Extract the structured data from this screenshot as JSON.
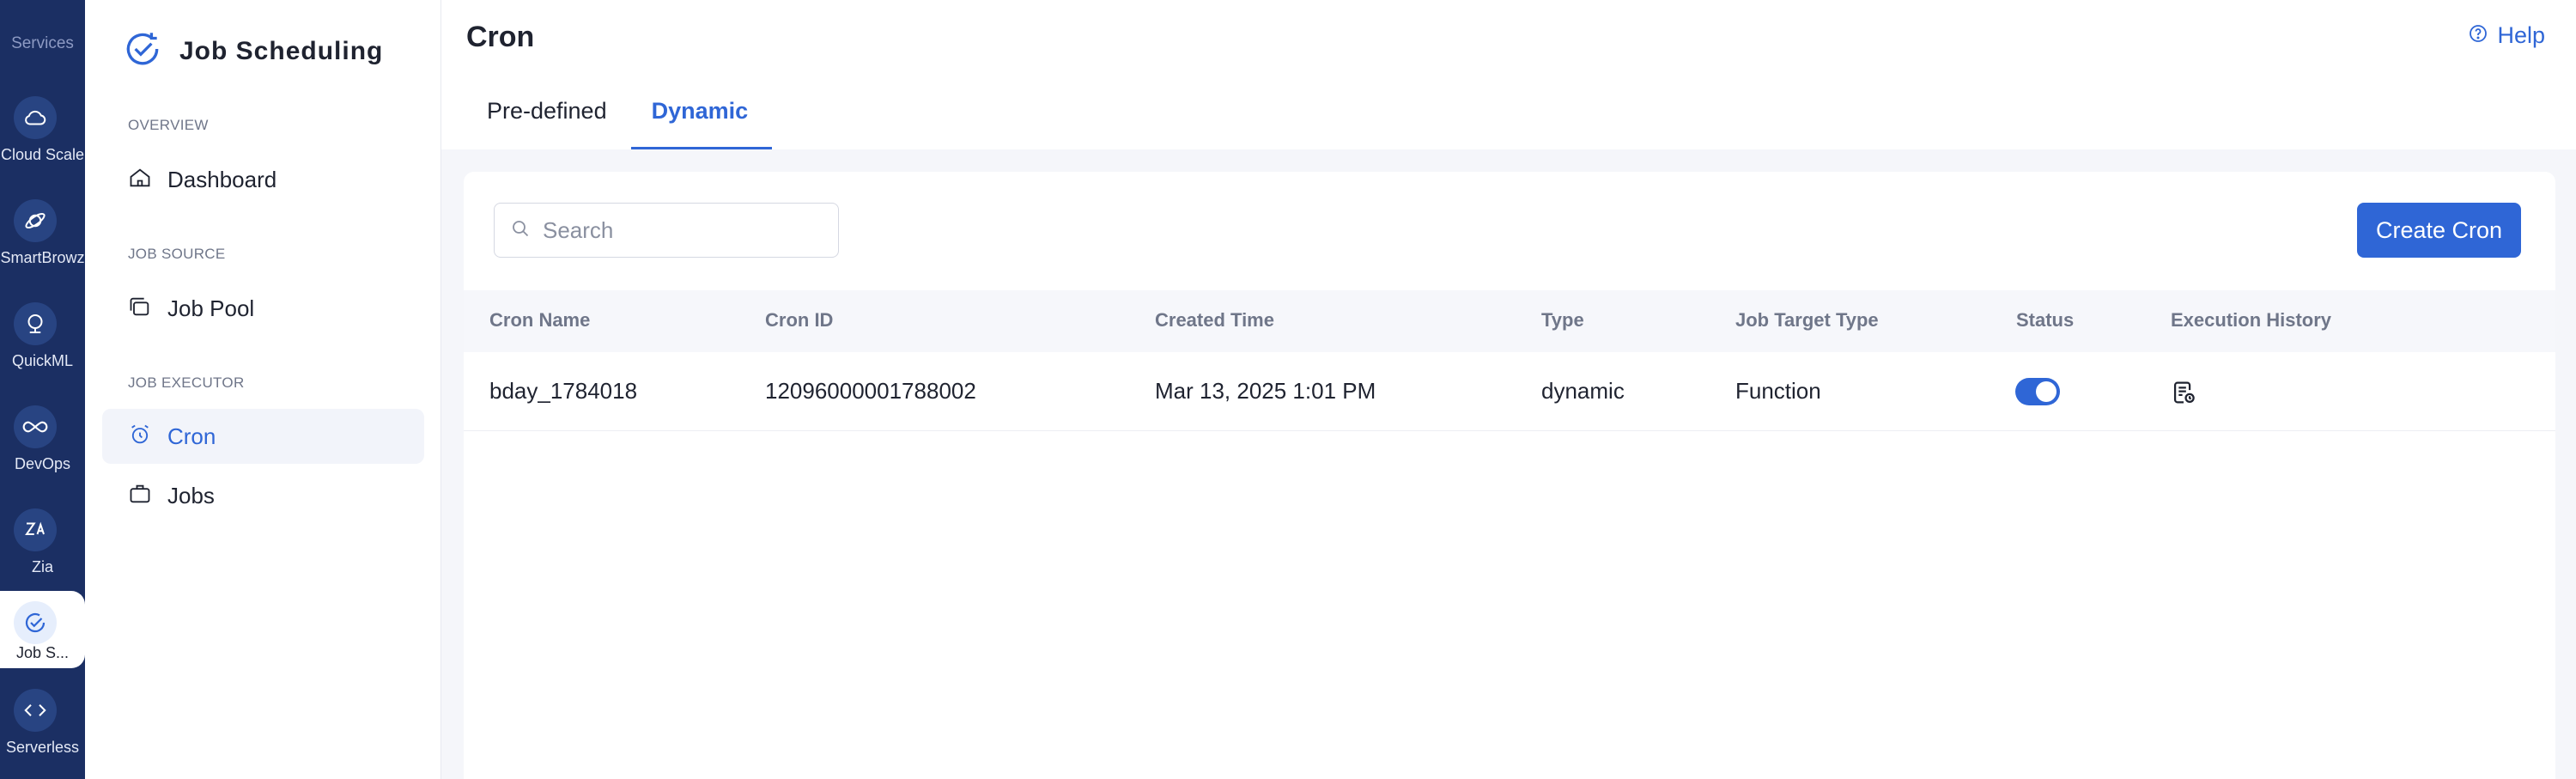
{
  "rail": {
    "heading": "Services",
    "items": [
      {
        "label": "Cloud Scale",
        "icon": "cloud-icon"
      },
      {
        "label": "SmartBrowz",
        "icon": "planet-icon"
      },
      {
        "label": "QuickML",
        "icon": "robot-head-icon"
      },
      {
        "label": "DevOps",
        "icon": "infinity-icon"
      },
      {
        "label": "Zia",
        "icon": "zia-icon"
      },
      {
        "label": "Job S...",
        "icon": "job-scheduling-icon",
        "active": true
      },
      {
        "label": "Serverless",
        "icon": "code-icon"
      }
    ]
  },
  "sidebar": {
    "title": "Job Scheduling",
    "sections": [
      {
        "heading": "OVERVIEW",
        "items": [
          {
            "label": "Dashboard",
            "icon": "home-icon"
          }
        ]
      },
      {
        "heading": "JOB SOURCE",
        "items": [
          {
            "label": "Job Pool",
            "icon": "layers-icon"
          }
        ]
      },
      {
        "heading": "JOB EXECUTOR",
        "items": [
          {
            "label": "Cron",
            "icon": "alarm-clock-icon",
            "active": true
          },
          {
            "label": "Jobs",
            "icon": "briefcase-icon"
          }
        ]
      }
    ]
  },
  "header": {
    "title": "Cron",
    "help_label": "Help",
    "tabs": [
      {
        "label": "Pre-defined"
      },
      {
        "label": "Dynamic",
        "active": true
      }
    ]
  },
  "toolbar": {
    "search_placeholder": "Search",
    "create_label": "Create Cron"
  },
  "table": {
    "columns": [
      "Cron Name",
      "Cron ID",
      "Created Time",
      "Type",
      "Job Target Type",
      "Status",
      "Execution History"
    ],
    "rows": [
      {
        "name": "bday_1784018",
        "id": "12096000001788002",
        "created": "Mar 13, 2025 1:01 PM",
        "type": "dynamic",
        "target": "Function",
        "status_on": true
      }
    ]
  },
  "colors": {
    "accent": "#2f66d6",
    "rail": "#1b2f63"
  }
}
